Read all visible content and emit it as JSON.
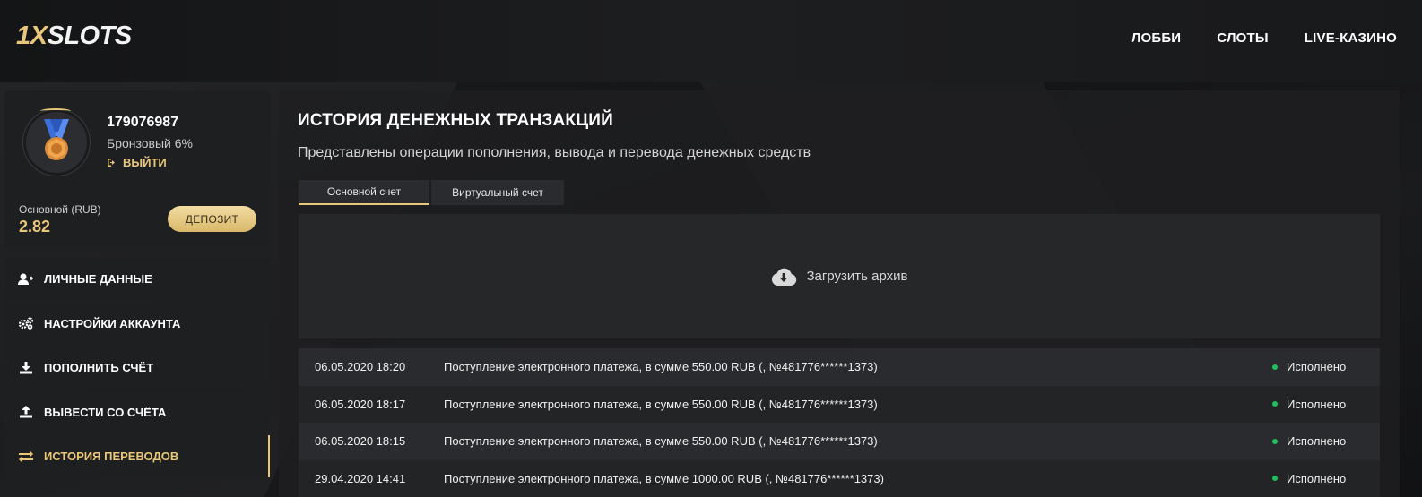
{
  "header": {
    "logo_prefix": "1X",
    "logo_suffix": "SLOTS",
    "nav": [
      {
        "label": "ЛОББИ"
      },
      {
        "label": "СЛОТЫ"
      },
      {
        "label": "LIVE-КАЗИНО"
      }
    ]
  },
  "profile": {
    "user_id": "179076987",
    "level": "Бронзовый 6%",
    "logout_label": "ВЫЙТИ",
    "balance_label": "Основной (RUB)",
    "balance_value": "2.82",
    "deposit_label": "ДЕПОЗИТ"
  },
  "menu": [
    {
      "label": "ЛИЧНЫЕ ДАННЫЕ",
      "icon": "user-plus-icon"
    },
    {
      "label": "НАСТРОЙКИ АККАУНТА",
      "icon": "gears-icon"
    },
    {
      "label": "ПОПОЛНИТЬ СЧЁТ",
      "icon": "download-icon"
    },
    {
      "label": "ВЫВЕСТИ СО СЧЁТА",
      "icon": "upload-icon"
    },
    {
      "label": "ИСТОРИЯ ПЕРЕВОДОВ",
      "icon": "exchange-icon",
      "active": true
    }
  ],
  "main": {
    "title": "ИСТОРИЯ ДЕНЕЖНЫХ ТРАНЗАКЦИЙ",
    "subtitle": "Представлены операции пополнения, вывода и перевода денежных средств",
    "tabs": [
      {
        "label": "Основной счет",
        "active": true
      },
      {
        "label": "Виртуальный счет"
      }
    ],
    "archive_label": "Загрузить архив",
    "transactions": [
      {
        "date": "06.05.2020 18:20",
        "description": "Поступление электронного платежа, в сумме 550.00 RUB (, №481776******1373)",
        "status": "Исполнено"
      },
      {
        "date": "06.05.2020 18:17",
        "description": "Поступление электронного платежа, в сумме 550.00 RUB (, №481776******1373)",
        "status": "Исполнено"
      },
      {
        "date": "06.05.2020 18:15",
        "description": "Поступление электронного платежа, в сумме 550.00 RUB (, №481776******1373)",
        "status": "Исполнено"
      },
      {
        "date": "29.04.2020 14:41",
        "description": "Поступление электронного платежа, в сумме 1000.00 RUB (, №481776******1373)",
        "status": "Исполнено"
      }
    ]
  },
  "colors": {
    "accent": "#e8c77a",
    "status_ok": "#1fbf5e"
  }
}
